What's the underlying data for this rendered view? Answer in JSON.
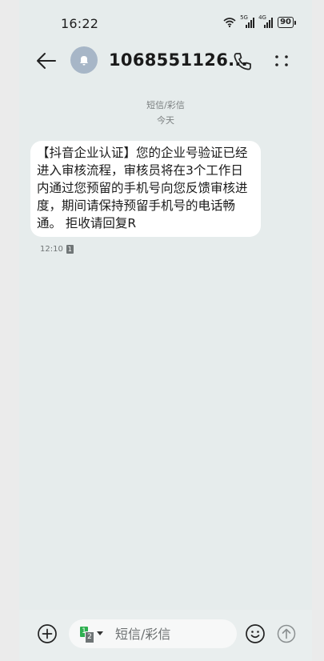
{
  "status_bar": {
    "time": "16:22",
    "signal1_label": "5G",
    "signal2_label": "4G",
    "battery": "90"
  },
  "header": {
    "title": "1068551126...",
    "icons": [
      "back-arrow-icon",
      "avatar-bell-icon",
      "phone-icon",
      "more-dots-icon"
    ]
  },
  "conversation": {
    "channel_label": "短信/彩信",
    "date_label": "今天",
    "messages": [
      {
        "text": "【抖音企业认证】您的企业号验证已经进入审核流程，审核员将在3个工作日内通过您预留的手机号向您反馈审核进度，期间请保持预留手机号的电话畅通。 拒收请回复R",
        "time": "12:10",
        "sim": "1"
      }
    ]
  },
  "composer": {
    "placeholder": "短信/彩信",
    "sim_primary": "1",
    "sim_secondary": "2",
    "icons": [
      "add-icon",
      "emoji-icon",
      "send-arrow-icon"
    ]
  },
  "colors": {
    "background": "#e6ecec",
    "bubble": "#ffffff",
    "sim1": "#2eb050",
    "avatar": "#a7b6c7"
  }
}
